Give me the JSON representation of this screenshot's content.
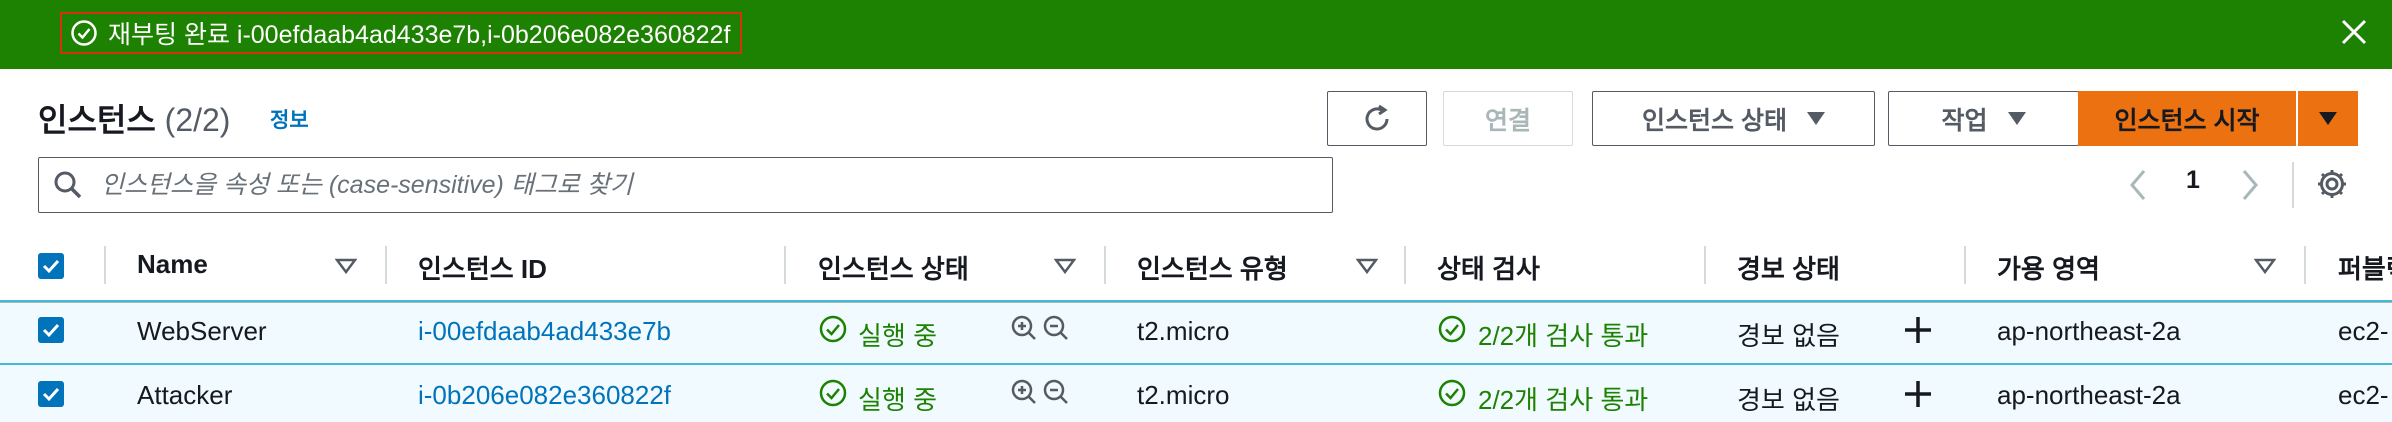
{
  "flash": {
    "message": "재부팅 완료 i-00efdaab4ad433e7b,i-0b206e082e360822f",
    "status_icon": "check-circle-icon",
    "close_icon": "close-icon"
  },
  "header": {
    "title": "인스턴스",
    "count": "(2/2)",
    "info_link": "정보"
  },
  "toolbar": {
    "refresh_icon": "refresh-icon",
    "connect_label": "연결",
    "instance_state_label": "인스턴스 상태",
    "actions_label": "작업",
    "launch_label": "인스턴스 시작"
  },
  "search": {
    "placeholder": "인스턴스을 속성 또는 (case-sensitive) 태그로 찾기"
  },
  "pagination": {
    "current_page": "1"
  },
  "table": {
    "columns": [
      "Name",
      "인스턴스 ID",
      "인스턴스 상태",
      "인스턴스 유형",
      "상태 검사",
      "경보 상태",
      "가용 영역",
      "퍼블릭"
    ],
    "rows": [
      {
        "name": "WebServer",
        "instance_id": "i-00efdaab4ad433e7b",
        "state": "실행 중",
        "type": "t2.micro",
        "status_check": "2/2개 검사 통과",
        "alarm": "경보 없음",
        "az": "ap-northeast-2a",
        "public_dns": "ec2-"
      },
      {
        "name": "Attacker",
        "instance_id": "i-0b206e082e360822f",
        "state": "실행 중",
        "type": "t2.micro",
        "status_check": "2/2개 검사 통과",
        "alarm": "경보 없음",
        "az": "ap-northeast-2a",
        "public_dns": "ec2-"
      }
    ]
  },
  "colors": {
    "flash_bg": "#1d8102",
    "primary": "#ec7211",
    "link": "#0073bb",
    "success": "#1d8102"
  }
}
